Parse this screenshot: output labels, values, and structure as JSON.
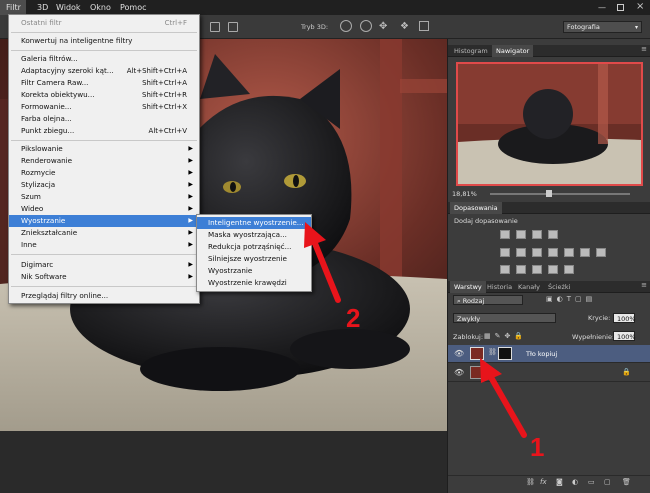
{
  "menubar": {
    "items": [
      "Filtr",
      "3D",
      "Widok",
      "Okno",
      "Pomoc"
    ]
  },
  "optbar": {
    "mode_label": "Tryb 3D:",
    "workspace": "Fotografia"
  },
  "filter_menu": {
    "last_filter": {
      "label": "Ostatni filtr",
      "shortcut": "Ctrl+F"
    },
    "convert": "Konwertuj na inteligentne filtry",
    "gallery": "Galeria filtrów...",
    "adaptive_wide": {
      "label": "Adaptacyjny szeroki kąt...",
      "shortcut": "Alt+Shift+Ctrl+A"
    },
    "camera_raw": {
      "label": "Filtr Camera Raw...",
      "shortcut": "Shift+Ctrl+A"
    },
    "lens_correction": {
      "label": "Korekta obiektywu...",
      "shortcut": "Shift+Ctrl+R"
    },
    "liquify": {
      "label": "Formowanie...",
      "shortcut": "Shift+Ctrl+X"
    },
    "oil_paint": "Farba olejna...",
    "vanishing_point": {
      "label": "Punkt zbiegu...",
      "shortcut": "Alt+Ctrl+V"
    },
    "groups": [
      "Pikslowanie",
      "Renderowanie",
      "Rozmycie",
      "Stylizacja",
      "Szum",
      "Wideo",
      "Wyostrzanie",
      "Zniekształcanie",
      "Inne"
    ],
    "plugins": [
      "Digimarc",
      "Nik Software"
    ],
    "browse_online": "Przeglądaj filtry online..."
  },
  "sharpen_submenu": [
    "Inteligentne wyostrzenie...",
    "Maska wyostrzająca...",
    "Redukcja potrząśnięć...",
    "Silniejsze wyostrzenie",
    "Wyostrzanie",
    "Wyostrzenie krawędzi"
  ],
  "navigator": {
    "tabs": [
      "Histogram",
      "Nawigator"
    ],
    "zoom": "18,81%"
  },
  "adjustments": {
    "tab": "Dopasowania",
    "title": "Dodaj dopasowanie"
  },
  "layers": {
    "tabs": [
      "Warstwy",
      "Historia",
      "Kanały",
      "Ścieżki"
    ],
    "filter_kind": "Rodzaj",
    "blend_mode": "Zwykły",
    "opacity_label": "Krycie:",
    "opacity_value": "100%",
    "lock_label": "Zablokuj:",
    "fill_label": "Wypełnienie:",
    "fill_value": "100%",
    "layer_copy_name": "Tło kopiuj",
    "background_name": "Tło",
    "footer_fx": "fx"
  },
  "annotations": {
    "arrow1": "1",
    "arrow2": "2"
  },
  "colors": {
    "highlight": "#3d7fd6",
    "arrow": "#e8141b",
    "layer_selected": "#4c5d80"
  }
}
